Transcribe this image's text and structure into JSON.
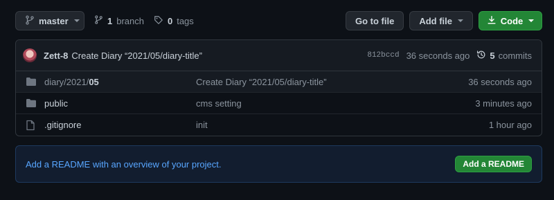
{
  "toolbar": {
    "branch_label": "master",
    "branch_count": "1",
    "branch_word": "branch",
    "tag_count": "0",
    "tag_word": "tags",
    "go_to_file": "Go to file",
    "add_file": "Add file",
    "code": "Code"
  },
  "commit": {
    "author": "Zett-8",
    "message": "Create Diary “2021/05/diary-title”",
    "sha": "812bccd",
    "age": "36 seconds ago",
    "commit_count": "5",
    "commit_word": "commits"
  },
  "files": [
    {
      "type": "folder",
      "name_prefix": "diary/2021/",
      "name_strong": "05",
      "commit": "Create Diary “2021/05/diary-title”",
      "age": "36 seconds ago"
    },
    {
      "type": "folder",
      "name": "public",
      "commit": "cms setting",
      "age": "3 minutes ago"
    },
    {
      "type": "file",
      "name": ".gitignore",
      "commit": "init",
      "age": "1 hour ago"
    }
  ],
  "readme": {
    "text": "Add a README with an overview of your project.",
    "button": "Add a README"
  },
  "colors": {
    "background": "#0d1117",
    "green_button": "#238636",
    "link_blue": "#58a6ff"
  }
}
